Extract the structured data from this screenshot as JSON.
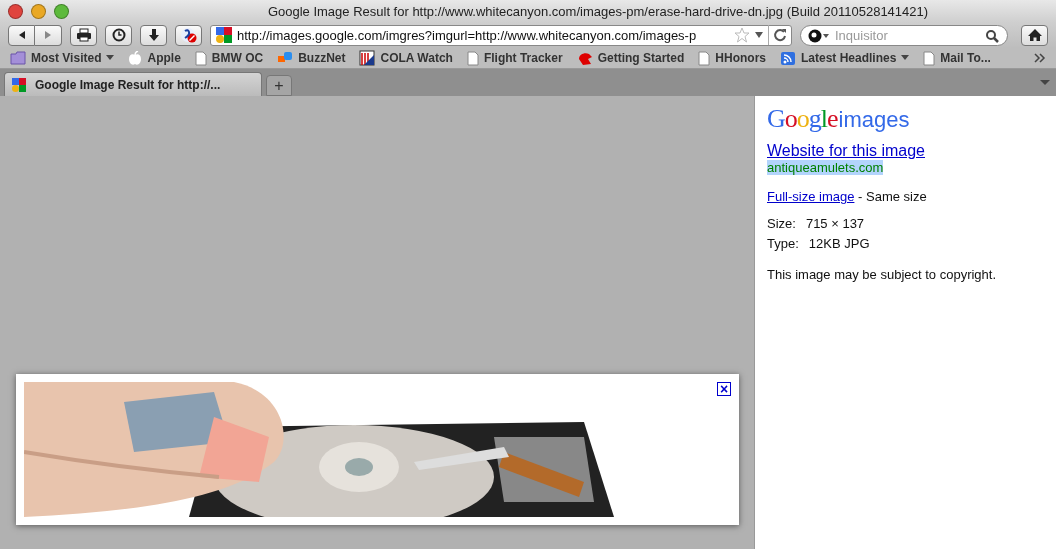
{
  "window": {
    "title": "Google Image Result for http://www.whitecanyon.com/images-pm/erase-hard-drive-dn.jpg (Build 20110528141421)"
  },
  "toolbar": {
    "url": "http://images.google.com/imgres?imgurl=http://www.whitecanyon.com/images-p",
    "search": {
      "placeholder": "Inquisitor"
    }
  },
  "bookmarks": [
    {
      "label": "Most Visited",
      "kind": "folder",
      "menu": true
    },
    {
      "label": "Apple",
      "kind": "apple",
      "menu": false
    },
    {
      "label": "BMW OC",
      "kind": "page",
      "menu": false
    },
    {
      "label": "BuzzNet",
      "kind": "buzz",
      "menu": false
    },
    {
      "label": "COLA Watch",
      "kind": "flag",
      "menu": false
    },
    {
      "label": "Flight Tracker",
      "kind": "page",
      "menu": false
    },
    {
      "label": "Getting Started",
      "kind": "red",
      "menu": false
    },
    {
      "label": "HHonors",
      "kind": "page",
      "menu": false
    },
    {
      "label": "Latest Headlines",
      "kind": "rss",
      "menu": true
    },
    {
      "label": "Mail To...",
      "kind": "page",
      "menu": false
    }
  ],
  "tabs": [
    {
      "label": "Google Image Result for http://...",
      "selected": true
    }
  ],
  "new_tab": "+",
  "preview": {
    "kind": "picture",
    "close": "×"
  },
  "panel": {
    "logo": {
      "brand": "Google",
      "product": "images"
    },
    "website_link": "Website for this image",
    "domain": "antiqueamulets.com",
    "fullsize_link": "Full-size image",
    "fullsize_note": " - Same size",
    "details": [
      {
        "label": "Size:",
        "value": "715 × 137"
      },
      {
        "label": "Type:",
        "value": "12KB JPG"
      }
    ],
    "notice": "This image may be subject to copyright."
  }
}
